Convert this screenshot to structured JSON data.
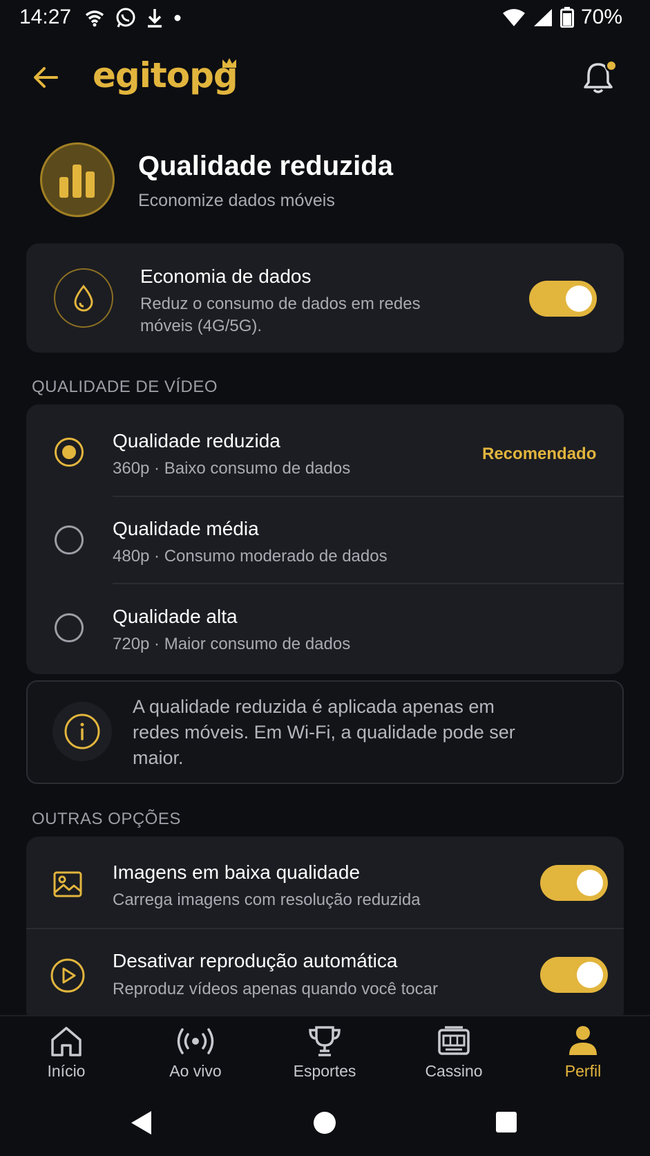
{
  "status_bar": {
    "time": "14:27",
    "battery": "70%",
    "left_icons": [
      "wifi-icon",
      "whatsapp-icon",
      "download-icon",
      "dot-icon"
    ],
    "right_icons": [
      "wifi-signal-icon",
      "cell-signal-icon",
      "battery-icon"
    ]
  },
  "header": {
    "logo_text": "egitopg",
    "back_icon": "arrow-left-icon",
    "bell_icon": "bell-icon"
  },
  "page": {
    "title": "Qualidade reduzida",
    "subtitle": "Economize dados móveis",
    "icon": "bar-chart-icon"
  },
  "data_saver": {
    "title": "Economia de dados",
    "description": "Reduz o consumo de dados em redes móveis (4G/5G).",
    "enabled": true,
    "icon": "water-drop-icon"
  },
  "video_quality": {
    "section_label": "QUALIDADE DE VÍDEO",
    "options": [
      {
        "title": "Qualidade reduzida",
        "subtitle": "360p · Baixo consumo de dados",
        "badge": "Recomendado",
        "selected": true
      },
      {
        "title": "Qualidade média",
        "subtitle": "480p · Consumo moderado de dados",
        "badge": "",
        "selected": false
      },
      {
        "title": "Qualidade alta",
        "subtitle": "720p · Maior consumo de dados",
        "badge": "",
        "selected": false
      }
    ]
  },
  "info": {
    "text": "A qualidade reduzida é aplicada apenas em redes móveis. Em Wi-Fi, a qualidade pode ser maior.",
    "icon": "info-icon"
  },
  "other_options": {
    "section_label": "OUTRAS OPÇÕES",
    "items": [
      {
        "title": "Imagens em baixa qualidade",
        "subtitle": "Carrega imagens com resolução reduzida",
        "enabled": true,
        "icon": "image-icon"
      },
      {
        "title": "Desativar reprodução automática",
        "subtitle": "Reproduz vídeos apenas quando você tocar",
        "enabled": true,
        "icon": "play-circle-icon"
      }
    ]
  },
  "bottom_nav": {
    "items": [
      {
        "label": "Início",
        "icon": "home-icon",
        "active": false
      },
      {
        "label": "Ao vivo",
        "icon": "live-broadcast-icon",
        "active": false
      },
      {
        "label": "Esportes",
        "icon": "trophy-icon",
        "active": false
      },
      {
        "label": "Cassino",
        "icon": "slot-machine-icon",
        "active": false
      },
      {
        "label": "Perfil",
        "icon": "user-icon",
        "active": true
      }
    ]
  },
  "system_nav": {
    "buttons": [
      "back-triangle-icon",
      "home-circle-icon",
      "recents-square-icon"
    ]
  },
  "colors": {
    "accent": "#e2b53d",
    "background": "#0d0e12",
    "card": "#1c1d22",
    "muted_text": "#a9abb3"
  }
}
